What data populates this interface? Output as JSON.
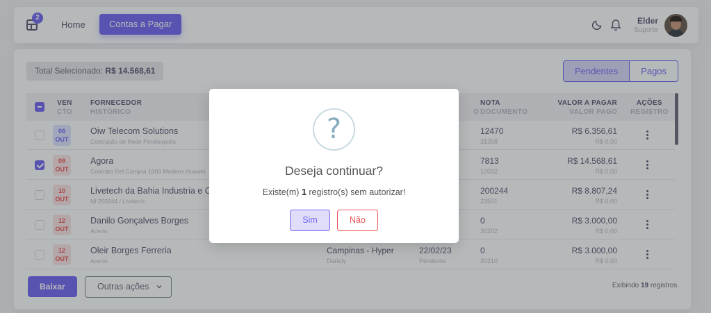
{
  "header": {
    "apps_badge": "2",
    "nav_home": "Home",
    "nav_active": "Contas a Pagar",
    "user_name": "Elder",
    "user_role": "Suporte"
  },
  "summary": {
    "total_label": "Total Selecionado:",
    "total_value": "R$ 14.568,61"
  },
  "filter": {
    "pending": "Pendentes",
    "paid": "Pagos"
  },
  "table": {
    "headers": {
      "venc_top": "VEN",
      "venc_bottom": "CTO",
      "fornecedor": "FORNECEDOR",
      "historico": "HISTÓRICO",
      "venc_status_partial": "O",
      "nota": "NOTA",
      "documento": "DOCUMENTO",
      "valor_pagar": "VALOR A PAGAR",
      "valor_pago": "VALOR PAGO",
      "acoes": "AÇÕES",
      "registro": "REGISTRO"
    },
    "rows": [
      {
        "day": "06",
        "month": "OUT",
        "date_color": "blue",
        "checked": false,
        "fornecedor": "Oiw Telecom Solutions",
        "historico": "Contrução de Rede Perdinopolis",
        "cc": "",
        "cc_sub": "",
        "venc": "",
        "venc_sub": "",
        "nota": "12470",
        "documento": "31358",
        "valor_pagar": "R$ 6.356,61",
        "valor_pago": "R$ 0,00"
      },
      {
        "day": "09",
        "month": "OUT",
        "date_color": "red",
        "checked": true,
        "fornecedor": "Agora",
        "historico": "Contrato Ref Compra 1000 Modens Huawei",
        "cc": "",
        "cc_sub": "",
        "venc": "",
        "venc_sub": "",
        "nota": "7813",
        "documento": "12032",
        "valor_pagar": "R$ 14.568,61",
        "valor_pago": "R$ 0,00"
      },
      {
        "day": "10",
        "month": "OUT",
        "date_color": "red",
        "checked": false,
        "fornecedor": "Livetech da Bahia Industria e Comercio",
        "historico": "Nf 200244 / Livetech",
        "cc": "",
        "cc_sub": "",
        "venc": "",
        "venc_sub": "",
        "nota": "200244",
        "documento": "23501",
        "valor_pagar": "R$ 8.807,24",
        "valor_pago": "R$ 0,00"
      },
      {
        "day": "12",
        "month": "OUT",
        "date_color": "red",
        "checked": false,
        "fornecedor": "Danilo Gonçalves Borges",
        "historico": "Acerto",
        "cc": "",
        "cc_sub": "",
        "venc": "",
        "venc_sub": "",
        "nota": "0",
        "documento": "30202",
        "valor_pagar": "R$ 3.000,00",
        "valor_pago": "R$ 0,00"
      },
      {
        "day": "12",
        "month": "OUT",
        "date_color": "red",
        "checked": false,
        "fornecedor": "Oleir Borges Ferreria",
        "historico": "Acerto",
        "cc": "Campinas - Hyper",
        "cc_sub": "Dariely",
        "venc": "22/02/23",
        "venc_sub": "Pendente",
        "nota": "0",
        "documento": "30210",
        "valor_pagar": "R$ 3.000,00",
        "valor_pago": "R$ 0,00"
      }
    ]
  },
  "footer": {
    "baixar": "Baixar",
    "outras": "Outras ações",
    "showing_prefix": "Exibindo",
    "showing_count": "19",
    "showing_suffix": "registros."
  },
  "modal": {
    "icon_glyph": "?",
    "title": "Deseja continuar?",
    "text_prefix": "Existe(m)",
    "text_count": "1",
    "text_suffix": "registro(s) sem autorizar!",
    "confirm": "Sim",
    "cancel": "Não"
  },
  "colors": {
    "primary": "#7367f0",
    "danger": "#ea5455",
    "text": "#5e5873",
    "muted": "#b9b9c3"
  },
  "icons": {
    "apps": "apps-icon",
    "theme": "moon-icon",
    "notifications": "bell-icon",
    "row_actions": "more-vertical-icon",
    "dropdown": "chevron-down-icon",
    "modal": "question-icon"
  }
}
